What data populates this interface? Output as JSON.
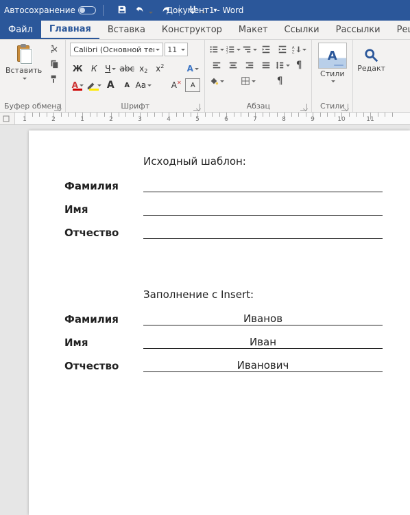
{
  "titlebar": {
    "autosave": "Автосохранение",
    "title": "Документ1 - Word"
  },
  "tabs": {
    "file": "Файл",
    "home": "Главная",
    "insert": "Вставка",
    "design": "Конструктор",
    "layout": "Макет",
    "references": "Ссылки",
    "mailings": "Рассылки",
    "review": "Рецензиров"
  },
  "ribbon": {
    "paste": "Вставить",
    "font": {
      "name": "Calibri (Основной текст",
      "size": "11"
    },
    "groups": {
      "clipboard": "Буфер обмена",
      "font": "Шрифт",
      "paragraph": "Абзац",
      "styles": "Стили",
      "styles_btn": "Стили",
      "editing": "Редакт"
    },
    "glyph": {
      "bold": "Ж",
      "italic": "К",
      "underline": "Ч",
      "strike": "abc",
      "a_big": "A",
      "a_small": "A",
      "aa": "Aa",
      "styles_A": "A"
    }
  },
  "ruler": {
    "nums": [
      "1",
      "2",
      "1",
      "2",
      "3",
      "4",
      "5",
      "6",
      "7",
      "8",
      "9",
      "10",
      "11"
    ]
  },
  "doc": {
    "section1": {
      "title": "Исходный шаблон:",
      "rows": [
        {
          "label": "Фамилия",
          "value": ""
        },
        {
          "label": "Имя",
          "value": ""
        },
        {
          "label": "Отчество",
          "value": ""
        }
      ]
    },
    "section2": {
      "title": "Заполнение с Insert:",
      "rows": [
        {
          "label": "Фамилия",
          "value": "Иванов"
        },
        {
          "label": "Имя",
          "value": "Иван"
        },
        {
          "label": "Отчество",
          "value": "Иванович"
        }
      ]
    }
  }
}
